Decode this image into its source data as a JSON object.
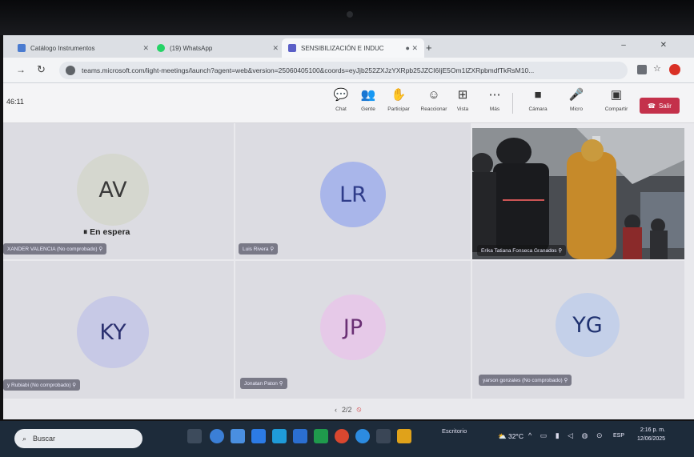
{
  "tabs": [
    {
      "label": "Catálogo Instrumentos",
      "color": "#4a7bd0"
    },
    {
      "label": "(19) WhatsApp",
      "color": "#25d366"
    },
    {
      "label": "SENSIBILIZACIÓN E INDUC",
      "color": "#5b5fc7"
    }
  ],
  "browser": {
    "url": "teams.microsoft.com/light-meetings/launch?agent=web&version=25060405100&coords=eyJjb252ZXJzYXRpb25JZCI6IjE5Om1lZXRpbmdfTkRsM10..."
  },
  "meeting": {
    "timer": "46:11",
    "controls": [
      {
        "name": "chat",
        "label": "Chat",
        "glyph": "💬"
      },
      {
        "name": "people",
        "label": "Gente",
        "glyph": "👥"
      },
      {
        "name": "raise-hand",
        "label": "Participar",
        "glyph": "✋"
      },
      {
        "name": "react",
        "label": "Reaccionar",
        "glyph": "☺"
      },
      {
        "name": "view",
        "label": "Vista",
        "glyph": "⊞"
      },
      {
        "name": "more",
        "label": "Más",
        "glyph": "⋯"
      },
      {
        "name": "camera",
        "label": "Cámara",
        "glyph": "■"
      },
      {
        "name": "mic",
        "label": "Micro",
        "glyph": "🎤"
      },
      {
        "name": "share",
        "label": "Compartir",
        "glyph": "▣"
      }
    ],
    "leave_label": "Salir"
  },
  "participants": [
    {
      "initials": "AV",
      "name": "XANDER VALENCIA (No comprobado)",
      "bg": "#d5d7cf",
      "fg": "#3a3a3a",
      "status": "En espera"
    },
    {
      "initials": "LR",
      "name": "Luis Rivera",
      "bg": "#a9b6ea",
      "fg": "#2f3c8a"
    },
    {
      "initials": "",
      "name": "Erika Tatiana Fonseca Granados",
      "video": true
    },
    {
      "initials": "KY",
      "name": "y Rubiabi (No comprobado)",
      "bg": "#c7c9e6",
      "fg": "#2b3070"
    },
    {
      "initials": "JP",
      "name": "Jonatan Paton",
      "bg": "#e6c9e8",
      "fg": "#6a2f74"
    },
    {
      "initials": "YG",
      "name": "yarson gonzales (No comprobado)",
      "bg": "#c4d0e9",
      "fg": "#1f3170"
    }
  ],
  "pager": "2/2",
  "taskbar": {
    "search_placeholder": "Buscar",
    "tray_label": "Escritorio",
    "temperature": "32°C",
    "language": "ESP",
    "time": "2:16 p. m.",
    "date": "12/06/2025"
  }
}
